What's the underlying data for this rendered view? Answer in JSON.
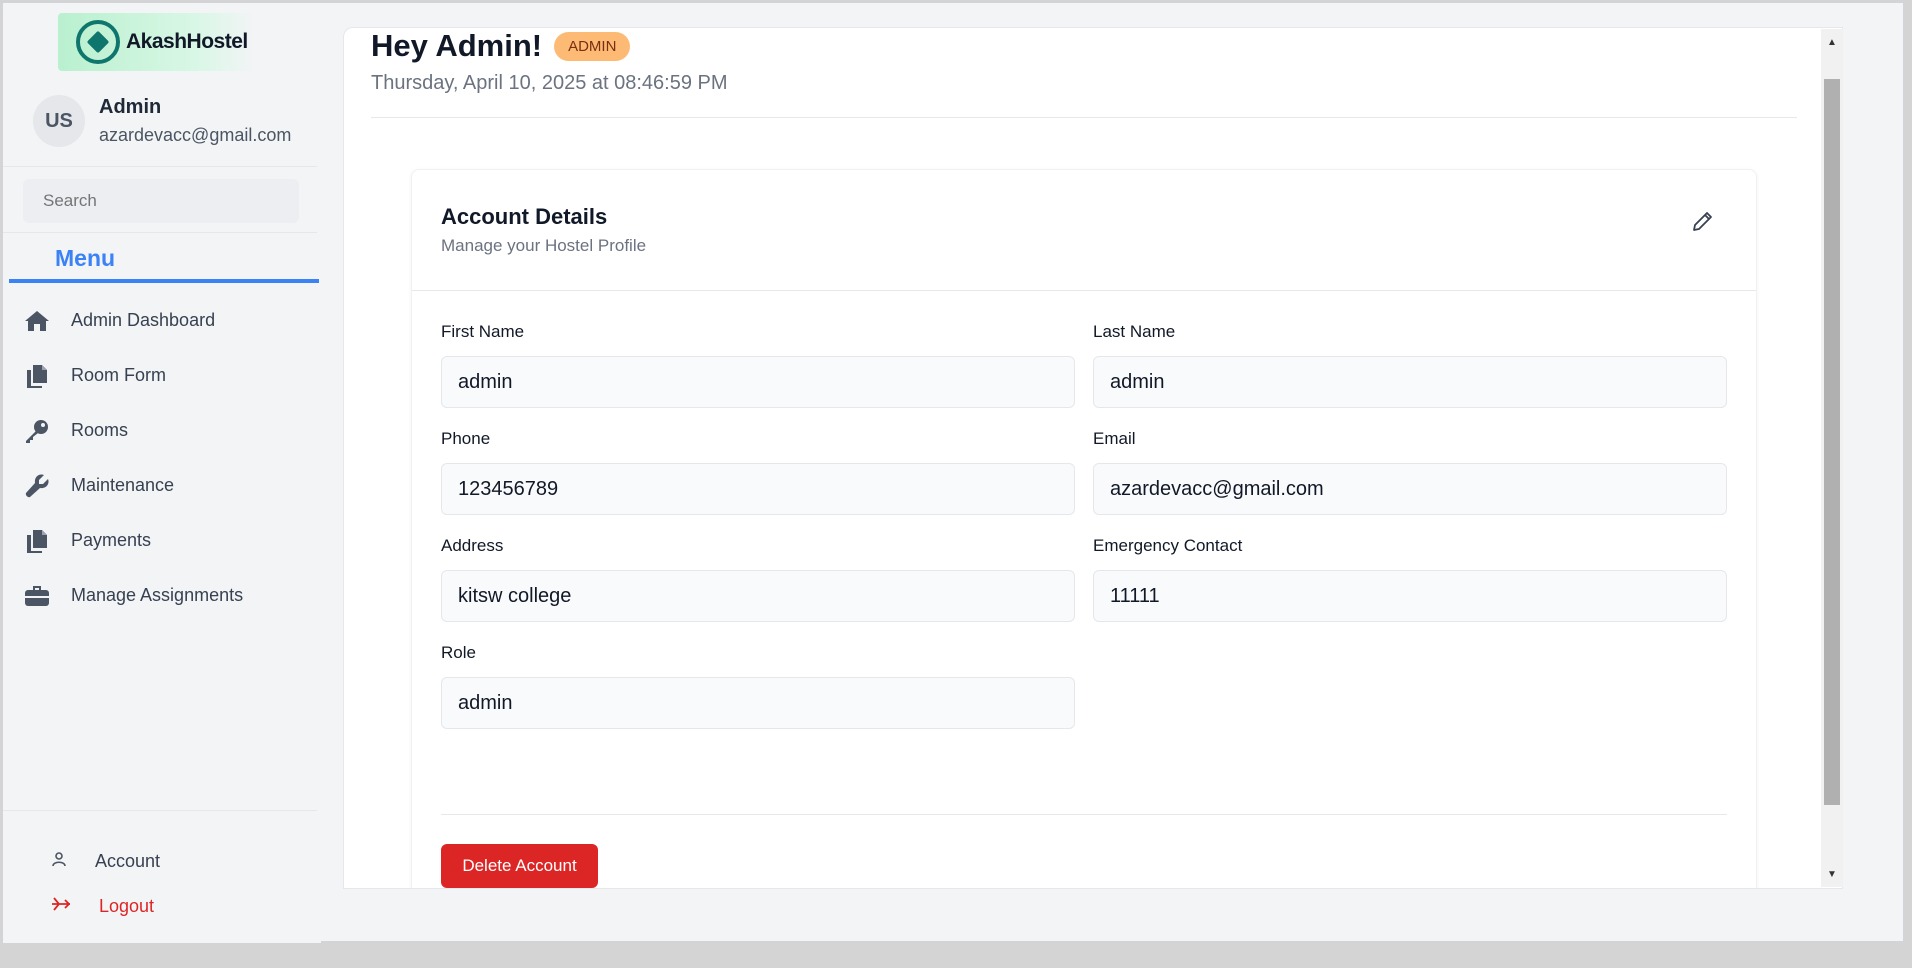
{
  "brand": {
    "name": "AkashHostel"
  },
  "profile": {
    "initials": "US",
    "name": "Admin",
    "email": "azardevacc@gmail.com"
  },
  "search": {
    "placeholder": "Search"
  },
  "menu": {
    "title": "Menu",
    "items": [
      {
        "label": "Admin Dashboard",
        "icon": "home-icon"
      },
      {
        "label": "Room Form",
        "icon": "documents-icon"
      },
      {
        "label": "Rooms",
        "icon": "key-icon"
      },
      {
        "label": "Maintenance",
        "icon": "wrench-icon"
      },
      {
        "label": "Payments",
        "icon": "documents-icon"
      },
      {
        "label": "Manage Assignments",
        "icon": "briefcase-icon"
      }
    ]
  },
  "bottom_nav": {
    "account_label": "Account",
    "logout_label": "Logout"
  },
  "header": {
    "greeting": "Hey Admin!",
    "role_badge": "ADMIN",
    "datetime": "Thursday, April 10, 2025 at 08:46:59 PM"
  },
  "card": {
    "title": "Account Details",
    "subtitle": "Manage your Hostel Profile",
    "fields": {
      "first_name": {
        "label": "First Name",
        "value": "admin"
      },
      "last_name": {
        "label": "Last Name",
        "value": "admin"
      },
      "phone": {
        "label": "Phone",
        "value": "123456789"
      },
      "email": {
        "label": "Email",
        "value": "azardevacc@gmail.com"
      },
      "address": {
        "label": "Address",
        "value": "kitsw college"
      },
      "emergency": {
        "label": "Emergency Contact",
        "value": "11111"
      },
      "role": {
        "label": "Role",
        "value": "admin"
      }
    },
    "delete_label": "Delete Account"
  },
  "colors": {
    "accent": "#3b82f6",
    "danger": "#dc2626",
    "badge_bg": "#fdba74",
    "brand_green": "#0f766e"
  }
}
